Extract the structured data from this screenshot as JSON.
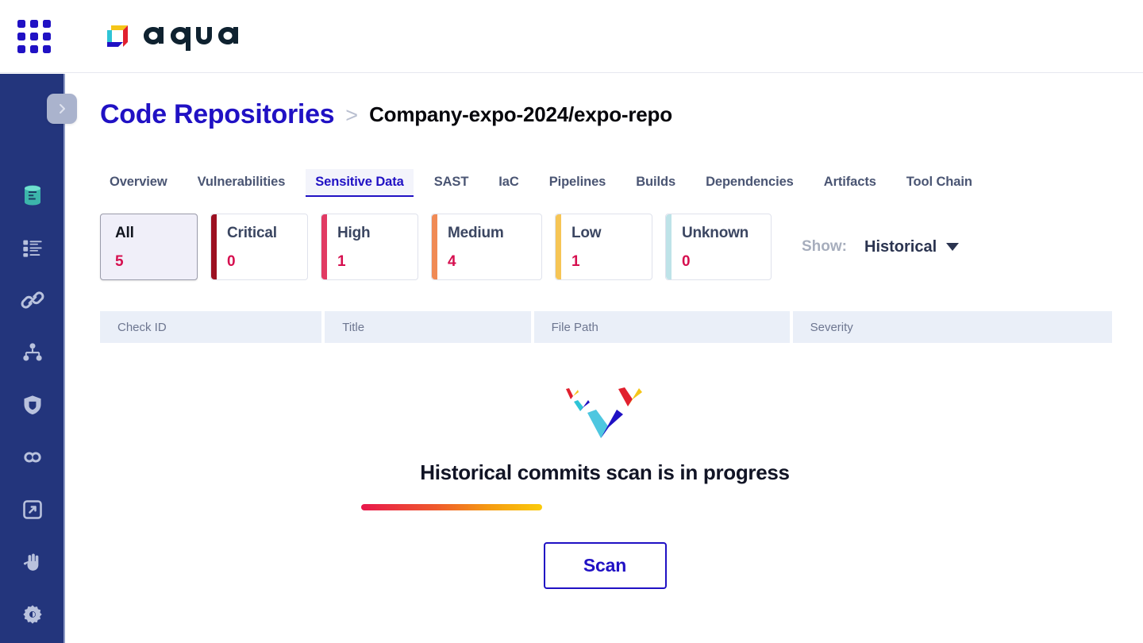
{
  "app": {
    "brand_name": "aqua",
    "grid_icon": "app-grid-icon",
    "accent": "#2011c4",
    "sidebar_bg": "#23357c"
  },
  "sidebar": {
    "toggle_icon": "chevron-right-icon",
    "items": [
      {
        "icon": "database-icon",
        "active": true
      },
      {
        "icon": "list-checklist-icon",
        "active": false
      },
      {
        "icon": "link-chain-icon",
        "active": false
      },
      {
        "icon": "org-hierarchy-icon",
        "active": false
      },
      {
        "icon": "shield-icon",
        "active": false
      },
      {
        "icon": "code-link-icon",
        "active": false
      },
      {
        "icon": "image-scan-icon",
        "active": false
      },
      {
        "icon": "hand-stop-icon",
        "active": false
      },
      {
        "icon": "settings-gear-icon",
        "active": false
      }
    ]
  },
  "breadcrumb": {
    "root": "Code Repositories",
    "separator": ">",
    "current": "Company-expo-2024/expo-repo"
  },
  "tabs": [
    {
      "label": "Overview",
      "active": false
    },
    {
      "label": "Vulnerabilities",
      "active": false
    },
    {
      "label": "Sensitive Data",
      "active": true
    },
    {
      "label": "SAST",
      "active": false
    },
    {
      "label": "IaC",
      "active": false
    },
    {
      "label": "Pipelines",
      "active": false
    },
    {
      "label": "Builds",
      "active": false
    },
    {
      "label": "Dependencies",
      "active": false
    },
    {
      "label": "Artifacts",
      "active": false
    },
    {
      "label": "Tool Chain",
      "active": false
    }
  ],
  "severity_cards": [
    {
      "label": "All",
      "count": "5",
      "bar_color": "",
      "selected": true
    },
    {
      "label": "Critical",
      "count": "0",
      "bar_color": "#9c1021",
      "selected": false
    },
    {
      "label": "High",
      "count": "1",
      "bar_color": "#e13a63",
      "selected": false
    },
    {
      "label": "Medium",
      "count": "4",
      "bar_color": "#f08a55",
      "selected": false
    },
    {
      "label": "Low",
      "count": "1",
      "bar_color": "#f6c555",
      "selected": false
    },
    {
      "label": "Unknown",
      "count": "0",
      "bar_color": "#bee3e8",
      "selected": false
    }
  ],
  "filter": {
    "show_label": "Show:",
    "show_value": "Historical",
    "caret_icon": "caret-down-icon"
  },
  "table": {
    "columns": [
      "Check ID",
      "Title",
      "File Path",
      "Severity"
    ]
  },
  "loading": {
    "spinner_icon": "aqua-chevrons-spinner",
    "title": "Historical commits scan is in progress",
    "progress_percent": 37,
    "progress_gradient_start": "#e8174c",
    "progress_gradient_end": "#fbcb0a"
  },
  "actions": {
    "scan_label": "Scan"
  }
}
